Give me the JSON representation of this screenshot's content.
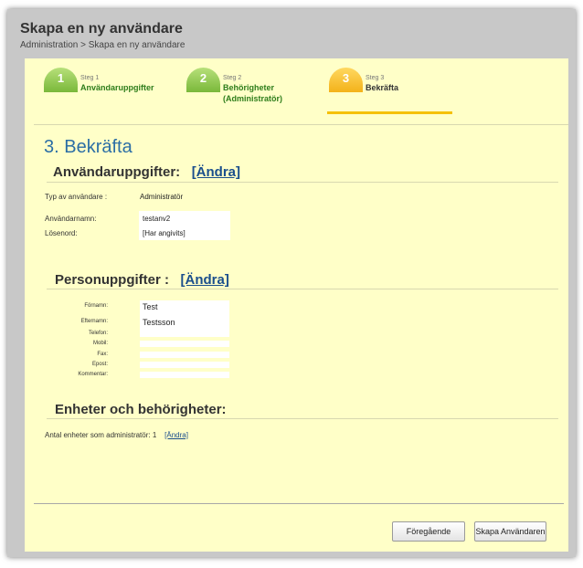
{
  "header": {
    "title": "Skapa en ny användare",
    "breadcrumb": "Administration > Skapa en ny användare"
  },
  "steps": [
    {
      "num": "1",
      "label": "Steg 1",
      "name": "Användaruppgifter",
      "name2": ""
    },
    {
      "num": "2",
      "label": "Steg 2",
      "name": "Behörigheter",
      "name2": "(Administratör)"
    },
    {
      "num": "3",
      "label": "Steg 3",
      "name": "Bekräfta",
      "name2": ""
    }
  ],
  "page_title": "3. Bekräfta",
  "user_section": {
    "heading": "Användaruppgifter:",
    "edit": "[Ändra]",
    "type_label": "Typ av användare :",
    "type_value": "Administratör",
    "username_label": "Användarnamn:",
    "username_value": "testanv2",
    "password_label": "Lösenord:",
    "password_value": "[Har angivits]"
  },
  "person_section": {
    "heading": "Personuppgifter :",
    "edit": "[Ändra]",
    "fields": [
      {
        "label": "Förnamn:",
        "value": "Test"
      },
      {
        "label": "Efternamn:",
        "value": "Testsson"
      },
      {
        "label": "Telefon:",
        "value": ""
      },
      {
        "label": "Mobil:",
        "value": ""
      },
      {
        "label": "Fax:",
        "value": ""
      },
      {
        "label": "Epost:",
        "value": ""
      },
      {
        "label": "Kommentar:",
        "value": ""
      }
    ]
  },
  "units_section": {
    "heading": "Enheter och behörigheter:",
    "count_text": "Antal enheter som administratör: 1",
    "edit": "[Ändra]"
  },
  "buttons": {
    "previous": "Föregående",
    "create": "Skapa Användaren"
  },
  "colors": {
    "panel_bg": "#ffffc8",
    "frame_bg": "#c8c8c8",
    "title_blue": "#2b6ea5",
    "step_green": "#7ab83a",
    "step_orange": "#f3b21a",
    "link": "#1a4e8c"
  }
}
